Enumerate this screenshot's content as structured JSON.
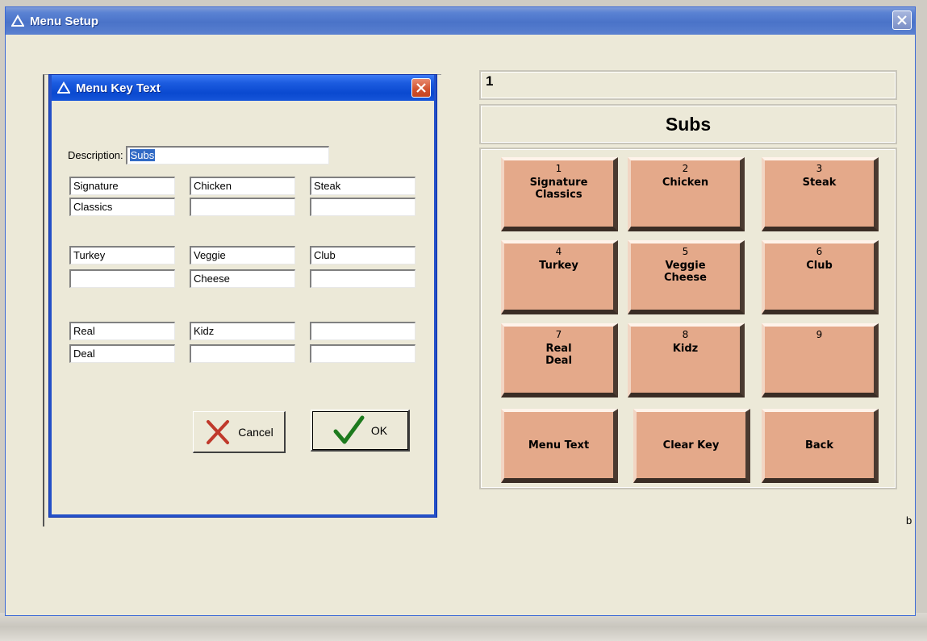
{
  "main_window": {
    "title": "Menu Setup"
  },
  "dialog": {
    "title": "Menu Key Text",
    "description_label": "Description:",
    "description_value": "Subs",
    "fields": [
      {
        "line1": "Signature",
        "line2": "Classics"
      },
      {
        "line1": "Chicken",
        "line2": ""
      },
      {
        "line1": "Steak",
        "line2": ""
      },
      {
        "line1": "Turkey",
        "line2": ""
      },
      {
        "line1": "Veggie",
        "line2": "Cheese"
      },
      {
        "line1": "Club",
        "line2": ""
      },
      {
        "line1": "Real",
        "line2": "Deal"
      },
      {
        "line1": "Kidz",
        "line2": ""
      },
      {
        "line1": "",
        "line2": ""
      }
    ],
    "cancel_label": "Cancel",
    "ok_label": "OK"
  },
  "panel": {
    "key_number": "1",
    "category": "Subs",
    "keys": [
      {
        "num": "1",
        "text": "Signature\nClassics"
      },
      {
        "num": "2",
        "text": "Chicken"
      },
      {
        "num": "3",
        "text": "Steak"
      },
      {
        "num": "4",
        "text": "Turkey"
      },
      {
        "num": "5",
        "text": "Veggie\nCheese"
      },
      {
        "num": "6",
        "text": "Club"
      },
      {
        "num": "7",
        "text": "Real\nDeal"
      },
      {
        "num": "8",
        "text": "Kidz"
      },
      {
        "num": "9",
        "text": ""
      }
    ],
    "commands": {
      "menu_text": "Menu Text",
      "clear_key": "Clear Key",
      "back": "Back"
    }
  },
  "side_text": "b",
  "colors": {
    "key_face": "#e4a98a",
    "dialog_titlebar": "#0a49d0",
    "window_bg": "#ece9d8",
    "selection": "#316ac5"
  }
}
